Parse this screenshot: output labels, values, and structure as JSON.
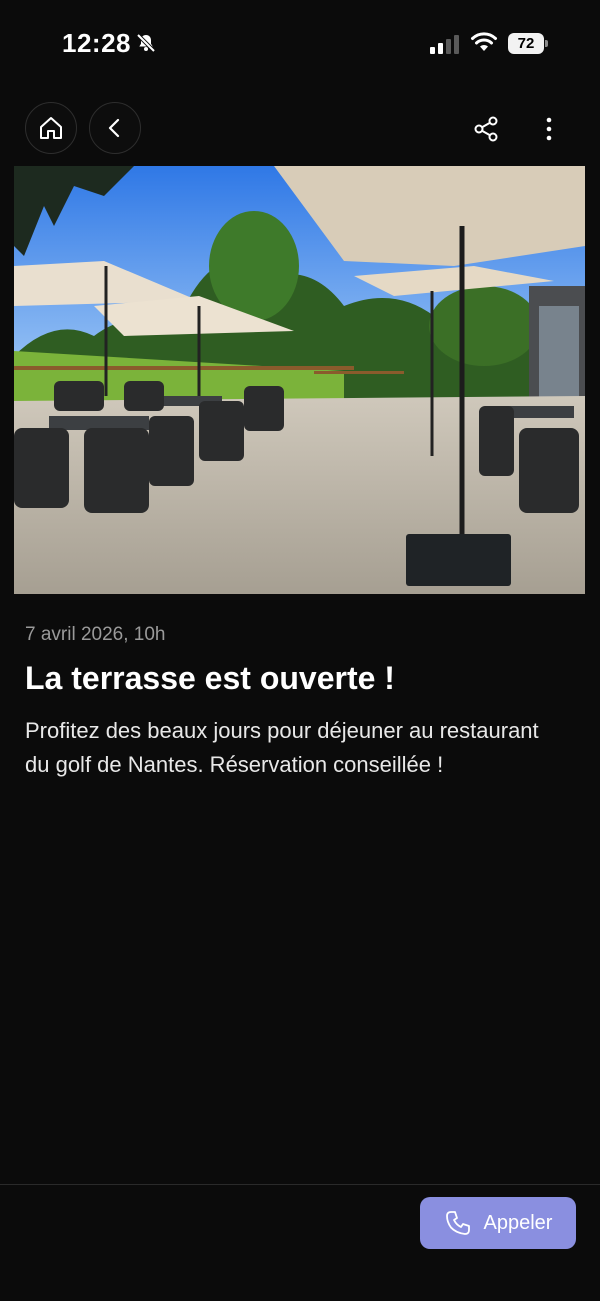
{
  "status_bar": {
    "time": "12:28",
    "battery": "72",
    "icons": [
      "bell-slash-icon",
      "signal-icon",
      "wifi-icon",
      "battery-icon"
    ]
  },
  "nav": {
    "icons": [
      "home-icon",
      "chevron-left-icon",
      "share-icon",
      "more-vertical-icon"
    ]
  },
  "article": {
    "date": "7 avril 2026, 10h",
    "title": "La terrasse est ouverte !",
    "body": "Profitez des beaux jours pour déjeuner au restaurant du golf de Nantes. Réservation conseillée !"
  },
  "footer": {
    "call_label": "Appeler",
    "call_icon": "phone-icon",
    "button_color": "#8a8fe0"
  }
}
